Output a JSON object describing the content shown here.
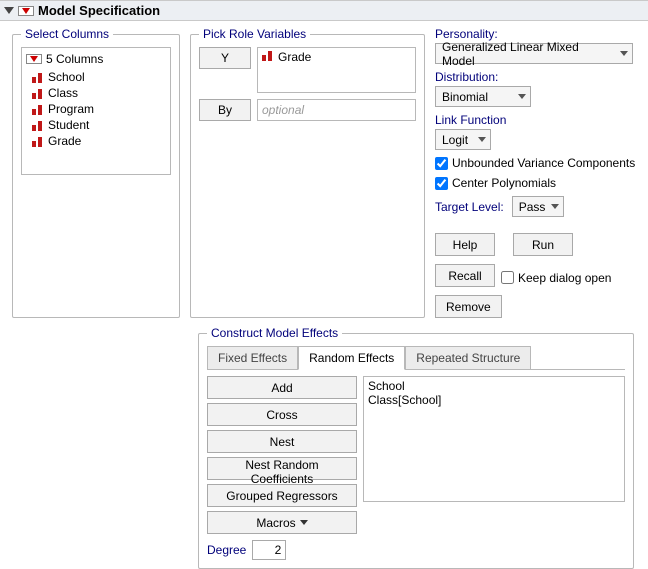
{
  "title": "Model Specification",
  "select_columns": {
    "legend": "Select Columns",
    "count_label": "5 Columns",
    "items": [
      "School",
      "Class",
      "Program",
      "Student",
      "Grade"
    ]
  },
  "roles": {
    "legend": "Pick Role Variables",
    "y_btn": "Y",
    "y_value": "Grade",
    "by_btn": "By",
    "by_placeholder": "optional"
  },
  "right": {
    "personality_label": "Personality:",
    "personality_value": "Generalized Linear Mixed Model",
    "distribution_label": "Distribution:",
    "distribution_value": "Binomial",
    "linkfn_label": "Link Function",
    "linkfn_value": "Logit",
    "unbounded_label": "Unbounded Variance Components",
    "center_label": "Center Polynomials",
    "target_label": "Target Level:",
    "target_value": "Pass",
    "help": "Help",
    "run": "Run",
    "recall": "Recall",
    "keep_open": "Keep dialog open",
    "remove": "Remove"
  },
  "construct": {
    "legend": "Construct Model Effects",
    "tabs": [
      "Fixed Effects",
      "Random Effects",
      "Repeated Structure"
    ],
    "active_tab": 1,
    "btns": {
      "add": "Add",
      "cross": "Cross",
      "nest": "Nest",
      "nest_random": "Nest Random Coefficients",
      "grouped": "Grouped Regressors",
      "macros": "Macros"
    },
    "effects": [
      "School",
      "Class[School]"
    ],
    "degree_label": "Degree",
    "degree_value": "2"
  }
}
